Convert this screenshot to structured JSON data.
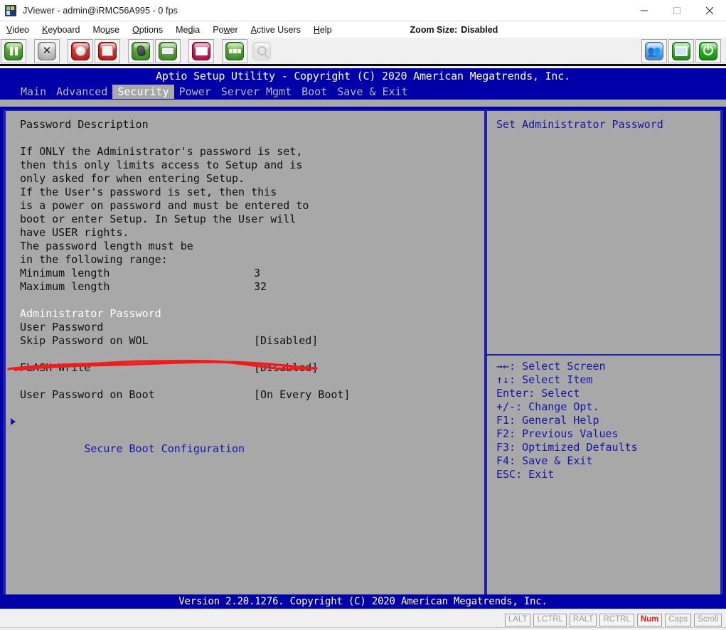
{
  "window": {
    "title": "JViewer - admin@iRMC56A995 - 0 fps",
    "icon": "jviewer-app-icon",
    "minimize": "minimize-icon",
    "maximize": "maximize-icon",
    "close": "close-icon"
  },
  "menubar": {
    "items": [
      {
        "pre": "",
        "mn": "V",
        "post": "ideo"
      },
      {
        "pre": "",
        "mn": "K",
        "post": "eyboard"
      },
      {
        "pre": "Mo",
        "mn": "u",
        "post": "se"
      },
      {
        "pre": "",
        "mn": "O",
        "post": "ptions"
      },
      {
        "pre": "Me",
        "mn": "d",
        "post": "ia"
      },
      {
        "pre": "Po",
        "mn": "w",
        "post": "er"
      },
      {
        "pre": "",
        "mn": "A",
        "post": "ctive Users"
      },
      {
        "pre": "",
        "mn": "H",
        "post": "elp"
      }
    ],
    "zoom_label": "Zoom Size:",
    "zoom_value": "Disabled"
  },
  "toolbar": {
    "buttons": [
      {
        "name": "pause-video-button",
        "icon": "pause-icon"
      },
      {
        "name": "fullscreen-button",
        "icon": "fullscreen-arrows-icon"
      },
      {
        "name": "cd-media-button",
        "icon": "cd-disc-icon"
      },
      {
        "name": "floppy-media-button",
        "icon": "floppy-drive-icon"
      },
      {
        "name": "mouse-button",
        "icon": "mouse-icon"
      },
      {
        "name": "keyboard-button",
        "icon": "keyboard-icon"
      },
      {
        "name": "record-video-button",
        "icon": "video-camera-icon"
      },
      {
        "name": "capture-button",
        "icon": "grid-capture-icon"
      },
      {
        "name": "zoom-button",
        "icon": "magnifier-icon",
        "disabled": true
      }
    ],
    "right_buttons": [
      {
        "name": "active-users-button",
        "icon": "users-icon"
      },
      {
        "name": "monitor-button",
        "icon": "monitor-icon"
      },
      {
        "name": "power-button",
        "icon": "power-icon"
      }
    ]
  },
  "bios": {
    "title": "Aptio Setup Utility - Copyright (C) 2020 American Megatrends, Inc.",
    "tabs": [
      {
        "label": "Main",
        "active": false
      },
      {
        "label": "Advanced",
        "active": false
      },
      {
        "label": "Security",
        "active": true
      },
      {
        "label": "Power",
        "active": false
      },
      {
        "label": "Server Mgmt",
        "active": false
      },
      {
        "label": "Boot",
        "active": false
      },
      {
        "label": "Save & Exit",
        "active": false
      }
    ],
    "left_rows": [
      {
        "label": "Password Description",
        "value": "",
        "style": "normal"
      },
      {
        "label": "",
        "value": "",
        "style": "spacer"
      },
      {
        "label": "If ONLY the Administrator's password is set,",
        "value": "",
        "style": "normal"
      },
      {
        "label": "then this only limits access to Setup and is",
        "value": "",
        "style": "normal"
      },
      {
        "label": "only asked for when entering Setup.",
        "value": "",
        "style": "normal"
      },
      {
        "label": "If the User's password is set, then this",
        "value": "",
        "style": "normal"
      },
      {
        "label": "is a power on password and must be entered to",
        "value": "",
        "style": "normal"
      },
      {
        "label": "boot or enter Setup. In Setup the User will",
        "value": "",
        "style": "normal"
      },
      {
        "label": "have USER rights.",
        "value": "",
        "style": "normal"
      },
      {
        "label": "The password length must be",
        "value": "",
        "style": "normal"
      },
      {
        "label": "in the following range:",
        "value": "",
        "style": "normal"
      },
      {
        "label": "Minimum length",
        "value": "3",
        "style": "normal"
      },
      {
        "label": "Maximum length",
        "value": "32",
        "style": "normal"
      },
      {
        "label": "",
        "value": "",
        "style": "spacer"
      },
      {
        "label": "Administrator Password",
        "value": "",
        "style": "selected"
      },
      {
        "label": "User Password",
        "value": "",
        "style": "normal"
      },
      {
        "label": "Skip Password on WOL",
        "value": "[Disabled]",
        "style": "normal"
      },
      {
        "label": "",
        "value": "",
        "style": "spacer"
      },
      {
        "label": "FLASH Write",
        "value": "[Disabled]",
        "style": "normal"
      },
      {
        "label": "",
        "value": "",
        "style": "spacer"
      },
      {
        "label": "User Password on Boot",
        "value": "[On Every Boot]",
        "style": "normal"
      },
      {
        "label": "",
        "value": "",
        "style": "spacer"
      },
      {
        "label": "Secure Boot Configuration",
        "value": "",
        "style": "submenu"
      }
    ],
    "help_title": "Set Administrator Password",
    "help_keys": [
      "→←: Select Screen",
      "↑↓: Select Item",
      "Enter: Select",
      "+/-: Change Opt.",
      "F1: General Help",
      "F2: Previous Values",
      "F3: Optimized Defaults",
      "F4: Save & Exit",
      "ESC: Exit"
    ],
    "footer": "Version 2.20.1276. Copyright (C) 2020 American Megatrends, Inc."
  },
  "annotation": {
    "name": "red-underline-flash-write",
    "color": "#f01c1c"
  },
  "statusbar": {
    "leds": [
      {
        "label": "LALT",
        "active": false
      },
      {
        "label": "LCTRL",
        "active": false
      },
      {
        "label": "RALT",
        "active": false
      },
      {
        "label": "RCTRL",
        "active": false
      },
      {
        "label": "Num",
        "active": true
      },
      {
        "label": "Caps",
        "active": false
      },
      {
        "label": "Scroll",
        "active": false
      }
    ]
  }
}
